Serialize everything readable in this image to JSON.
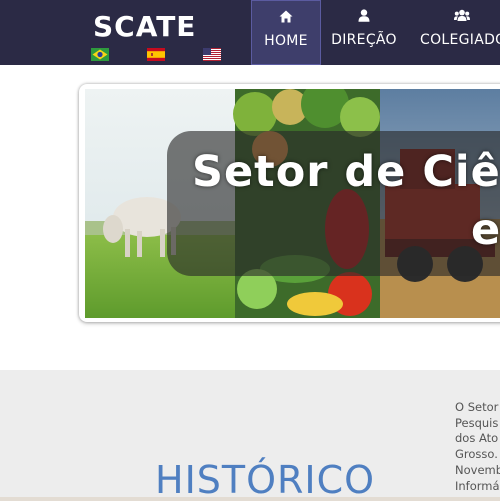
{
  "navbar": {
    "brand": "SCATE",
    "flags": [
      {
        "icon": "flag-brazil-icon"
      },
      {
        "icon": "flag-spain-icon"
      },
      {
        "icon": "flag-usa-icon"
      }
    ],
    "items": [
      {
        "label": "HOME",
        "icon": "home-icon",
        "active": true
      },
      {
        "label": "DIREÇÃO",
        "icon": "user-icon"
      },
      {
        "label": "COLEGIADO",
        "icon": "users-icon"
      }
    ]
  },
  "banner": {
    "line1": "Setor de Ciê",
    "line2": "e"
  },
  "history": {
    "title": "HISTÓRICO",
    "text_lines": [
      "O Setor",
      "Pesquis",
      "dos Ato",
      "Grosso.",
      "Novemb",
      "Informá"
    ]
  },
  "colors": {
    "navbar_bg": "#2b2a45",
    "nav_active_bg": "#3e3e6b",
    "history_bg": "#ededed",
    "history_title": "#4f7fc1"
  }
}
